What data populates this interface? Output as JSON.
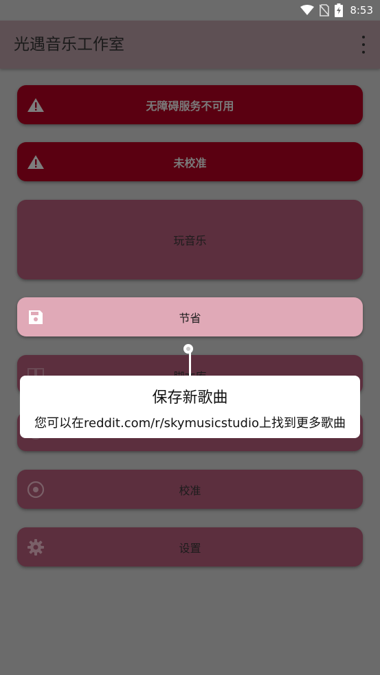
{
  "status_bar": {
    "time": "8:53",
    "icons": [
      "wifi-icon",
      "no-sim-icon",
      "battery-charging-icon"
    ]
  },
  "app_bar": {
    "title": "光遇音乐工作室",
    "overflow_icon": "more-vert-icon"
  },
  "buttons": {
    "accessibility": {
      "label": "无障碍服务不可用",
      "icon": "warning-icon"
    },
    "not_calibrated": {
      "label": "未校准",
      "icon": "warning-icon"
    },
    "play_music": {
      "label": "玩音乐"
    },
    "save": {
      "label": "节省",
      "icon": "save-icon"
    },
    "script_library": {
      "label": "脚本库",
      "icon": "book-icon"
    },
    "hidden_item": {
      "label": "",
      "icon": "circle-icon"
    },
    "calibrate": {
      "label": "校准",
      "icon": "target-icon"
    },
    "settings": {
      "label": "设置",
      "icon": "gear-icon"
    }
  },
  "tooltip": {
    "title": "保存新歌曲",
    "body": "您可以在reddit.com/r/skymusicstudio上找到更多歌曲"
  },
  "colors": {
    "scrim": "#6b6b6b",
    "warning_button": "#5a0011",
    "dim_button": "#5c2f3e",
    "highlight_button": "#e0a9b7"
  }
}
